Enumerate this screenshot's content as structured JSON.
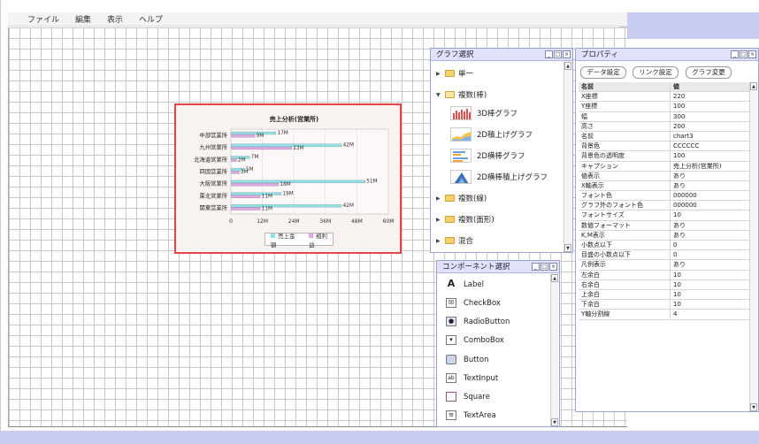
{
  "menu": {
    "items": [
      "ファイル",
      "編集",
      "表示",
      "ヘルプ"
    ]
  },
  "chart": {
    "title": "売上分析(営業所)"
  },
  "chart_data": {
    "type": "bar",
    "orientation": "horizontal",
    "title": "売上分析(営業所)",
    "categories": [
      "中部営業所",
      "九州営業所",
      "北海道営業所",
      "四国営業所",
      "大阪営業所",
      "東北営業所",
      "関東営業所"
    ],
    "series": [
      {
        "name": "売上金額",
        "color": "#8fe3ea",
        "values": [
          17,
          42,
          7,
          5,
          51,
          19,
          42
        ],
        "labels": [
          "17M",
          "42M",
          "7M",
          "5M",
          "51M",
          "19M",
          "42M"
        ]
      },
      {
        "name": "粗利益",
        "color": "#e2a7e6",
        "values": [
          9,
          23,
          2,
          3,
          18,
          11,
          11
        ],
        "labels": [
          "9M",
          "23M",
          "2M",
          "3M",
          "18M",
          "11M",
          "11M"
        ]
      }
    ],
    "xticks": [
      "0",
      "12M",
      "24M",
      "36M",
      "48M",
      "60M"
    ],
    "xlim": [
      0,
      60
    ],
    "grid": true,
    "legend": "bottom"
  },
  "graph_panel": {
    "title": "グラフ選択",
    "folders": [
      {
        "label": "単一",
        "expanded": false
      },
      {
        "label": "複数(棒)",
        "expanded": true
      },
      {
        "label": "複数(線)",
        "expanded": false
      },
      {
        "label": "複数(面形)",
        "expanded": false
      },
      {
        "label": "混合",
        "expanded": false
      }
    ],
    "graph_types": [
      "3D棒グラフ",
      "2D積上げグラフ",
      "2D横棒グラフ",
      "2D横棒積上げグラフ"
    ]
  },
  "component_panel": {
    "title": "コンポーネント選択",
    "items": [
      {
        "label": "Label",
        "icon": "label-icon",
        "glyph": "A"
      },
      {
        "label": "CheckBox",
        "icon": "checkbox-icon",
        "glyph": "☒"
      },
      {
        "label": "RadioButton",
        "icon": "radiobutton-icon",
        "glyph": "●"
      },
      {
        "label": "ComboBox",
        "icon": "combobox-icon",
        "glyph": "▾"
      },
      {
        "label": "Button",
        "icon": "button-icon",
        "glyph": ""
      },
      {
        "label": "TextInput",
        "icon": "textinput-icon",
        "glyph": "ab"
      },
      {
        "label": "Square",
        "icon": "square-icon",
        "glyph": ""
      },
      {
        "label": "TextArea",
        "icon": "textarea-icon",
        "glyph": "≡"
      }
    ]
  },
  "prop_panel": {
    "title": "プロパティ",
    "buttons": [
      "データ設定",
      "リンク設定",
      "グラフ変更"
    ],
    "header": {
      "name": "名前",
      "value": "値"
    },
    "rows": [
      {
        "name": "X座標",
        "value": "220"
      },
      {
        "name": "Y座標",
        "value": "100"
      },
      {
        "name": "幅",
        "value": "300"
      },
      {
        "name": "高さ",
        "value": "200"
      },
      {
        "name": "名前",
        "value": "chart3"
      },
      {
        "name": "背景色",
        "value": "CCCCCC"
      },
      {
        "name": "背景色の透明度",
        "value": "100"
      },
      {
        "name": "キャプション",
        "value": "売上分析(営業所)"
      },
      {
        "name": "値表示",
        "value": "あり"
      },
      {
        "name": "X軸表示",
        "value": "あり"
      },
      {
        "name": "フォント色",
        "value": "000000"
      },
      {
        "name": "グラフ外のフォント色",
        "value": "000000"
      },
      {
        "name": "フォントサイズ",
        "value": "10"
      },
      {
        "name": "数値フォーマット",
        "value": "あり"
      },
      {
        "name": "K,M表示",
        "value": "あり"
      },
      {
        "name": "小数点以下",
        "value": "0"
      },
      {
        "name": "目盛の小数点以下",
        "value": "0"
      },
      {
        "name": "凡例表示",
        "value": "あり"
      },
      {
        "name": "左余白",
        "value": "10"
      },
      {
        "name": "右余白",
        "value": "10"
      },
      {
        "name": "上余白",
        "value": "10"
      },
      {
        "name": "下余白",
        "value": "10"
      },
      {
        "name": "Y軸分割線",
        "value": "4"
      }
    ]
  }
}
